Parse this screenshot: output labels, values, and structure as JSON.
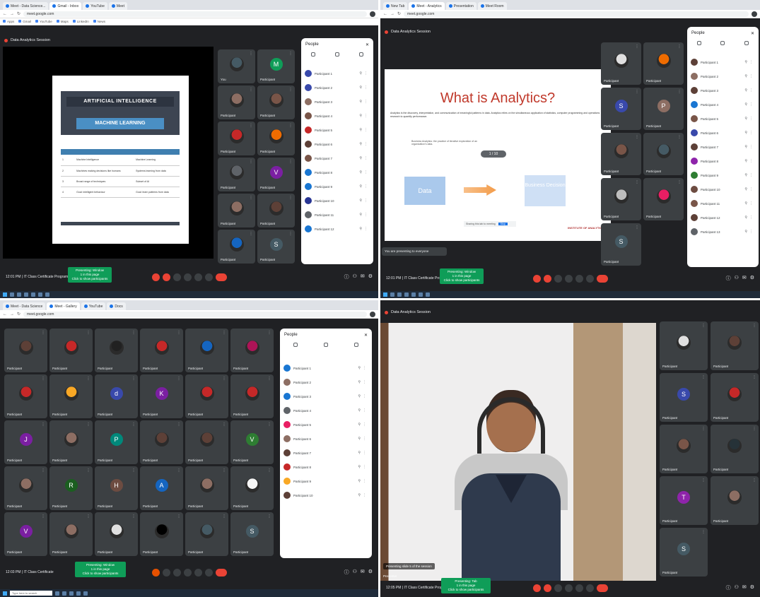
{
  "q1": {
    "tabs": [
      "Meet - Data Science...",
      "Gmail - Inbox",
      "YouTube",
      "Meet"
    ],
    "url": "meet.google.com",
    "bookmarks": [
      "Apps",
      "Gmail",
      "YouTube",
      "Maps",
      "LinkedIn",
      "News"
    ],
    "meeting_title": "Data Analytics Session",
    "slide": {
      "title1": "ARTIFICIAL INTELLIGENCE",
      "title2": "MACHINE LEARNING",
      "rows": [
        [
          "1",
          "Machine Intelligence",
          "Machine Learning"
        ],
        [
          "2",
          "Machines making decisions like humans",
          "Systems learning from data"
        ],
        [
          "3",
          "Broad range of techniques",
          "Subset of AI"
        ],
        [
          "4",
          "Goal: intelligent behaviour",
          "Goal: learn patterns from data"
        ]
      ]
    },
    "tiles": [
      {
        "name": "You",
        "color": "#455a64"
      },
      {
        "name": "Participant",
        "color": "#0f9d58",
        "letter": "M"
      },
      {
        "name": "Participant",
        "color": "#8d6e63"
      },
      {
        "name": "Participant",
        "color": "#795548"
      },
      {
        "name": "Participant",
        "color": "#c62828"
      },
      {
        "name": "Participant",
        "color": "#ef6c00"
      },
      {
        "name": "Participant",
        "color": "#5f6368"
      },
      {
        "name": "Participant",
        "color": "#7b1fa2",
        "letter": "V"
      },
      {
        "name": "Participant",
        "color": "#8d6e63"
      },
      {
        "name": "Participant",
        "color": "#5d4037"
      },
      {
        "name": "Participant",
        "color": "#1565c0"
      },
      {
        "name": "Participant",
        "color": "#455a64",
        "letter": "S"
      }
    ],
    "people_title": "People",
    "people": [
      {
        "name": "Participant 1",
        "color": "#3949ab"
      },
      {
        "name": "Participant 2",
        "color": "#3949ab"
      },
      {
        "name": "Participant 3",
        "color": "#8d6e63"
      },
      {
        "name": "Participant 4",
        "color": "#795548"
      },
      {
        "name": "Participant 5",
        "color": "#c62828"
      },
      {
        "name": "Participant 6",
        "color": "#5d4037"
      },
      {
        "name": "Participant 7",
        "color": "#795548"
      },
      {
        "name": "Participant 8",
        "color": "#1976d2"
      },
      {
        "name": "Participant 9",
        "color": "#1976d2"
      },
      {
        "name": "Participant 10",
        "color": "#283593"
      },
      {
        "name": "Participant 11",
        "color": "#5f6368"
      },
      {
        "name": "Participant 12",
        "color": "#1976d2"
      }
    ],
    "time": "12:01 PM | IT Class Certificate Program",
    "toast": "Presenting: Window\n1 in this page\nClick to show participants"
  },
  "q2": {
    "tabs": [
      "New Tab",
      "Meet - Analytics",
      "Presentation",
      "Meet Room"
    ],
    "url": "meet.google.com",
    "meeting_title": "Data Analytics Session",
    "slide": {
      "title": "What is Analytics?",
      "body": "Analytics is the discovery, interpretation, and communication of meaningful patterns in data. Analytics relies on the simultaneous application of statistics, computer programming and operations research to quantify performance.",
      "quote": "Business Analytics: the practice of iterative exploration of an organization's data.",
      "zoom_label": "1 / 10",
      "box1": "Data",
      "box2": "Business Decision",
      "logo": "INSTITUTE OF ANALYTICS",
      "share_text": "Sharing this tab to meeting",
      "share_btn": "Stop"
    },
    "stop_presenting": "You are presenting to everyone",
    "people_title": "People",
    "people": [
      {
        "name": "Participant 1",
        "color": "#5d4037"
      },
      {
        "name": "Participant 2",
        "color": "#8d6e63"
      },
      {
        "name": "Participant 3",
        "color": "#5d4037"
      },
      {
        "name": "Participant 4",
        "color": "#1976d2"
      },
      {
        "name": "Participant 5",
        "color": "#795548"
      },
      {
        "name": "Participant 6",
        "color": "#3949ab"
      },
      {
        "name": "Participant 7",
        "color": "#5d4037"
      },
      {
        "name": "Participant 8",
        "color": "#8e24aa"
      },
      {
        "name": "Participant 9",
        "color": "#2e7d32"
      },
      {
        "name": "Participant 10",
        "color": "#6d4c41"
      },
      {
        "name": "Participant 11",
        "color": "#795548"
      },
      {
        "name": "Participant 12",
        "color": "#5d4037"
      },
      {
        "name": "Participant 13",
        "color": "#5f6368"
      }
    ],
    "tiles": [
      {
        "name": "Participant",
        "color": "#e0e0e0"
      },
      {
        "name": "Participant",
        "color": "#ef6c00"
      },
      {
        "name": "Participant",
        "color": "#3949ab",
        "letter": "S"
      },
      {
        "name": "Participant",
        "color": "#8d6e63",
        "letter": "P"
      },
      {
        "name": "Participant",
        "color": "#795548"
      },
      {
        "name": "Participant",
        "color": "#455a64"
      },
      {
        "name": "Participant",
        "color": "#bdbdbd"
      },
      {
        "name": "Participant",
        "color": "#e91e63"
      },
      {
        "name": "Participant",
        "color": "#455a64",
        "letter": "S"
      }
    ],
    "time": "12:01 PM | IT Class Certificate Program",
    "toast": "Presenting: Window\n1 in this page\nClick to show participants"
  },
  "q3": {
    "tabs": [
      "Meet - Data Science",
      "Meet - Gallery",
      "YouTube",
      "Docs"
    ],
    "url": "meet.google.com",
    "people_title": "People",
    "people": [
      {
        "name": "Participant 1",
        "color": "#1976d2"
      },
      {
        "name": "Participant 2",
        "color": "#8d6e63"
      },
      {
        "name": "Participant 3",
        "color": "#1976d2"
      },
      {
        "name": "Participant 4",
        "color": "#5f6368"
      },
      {
        "name": "Participant 5",
        "color": "#e91e63"
      },
      {
        "name": "Participant 6",
        "color": "#8d6e63"
      },
      {
        "name": "Participant 7",
        "color": "#5d4037"
      },
      {
        "name": "Participant 8",
        "color": "#c62828"
      },
      {
        "name": "Participant 9",
        "color": "#f9a825"
      },
      {
        "name": "Participant 10",
        "color": "#5d4037"
      }
    ],
    "grid": [
      {
        "name": "Participant",
        "color": "#5d4037"
      },
      {
        "name": "Participant",
        "color": "#c62828"
      },
      {
        "name": "Participant",
        "color": "#212121"
      },
      {
        "name": "Participant",
        "color": "#c62828"
      },
      {
        "name": "Participant",
        "color": "#1565c0"
      },
      {
        "name": "Participant",
        "color": "#ad1457"
      },
      {
        "name": "Participant",
        "color": "#c62828"
      },
      {
        "name": "Participant",
        "color": "#f9a825"
      },
      {
        "name": "Participant",
        "color": "#3949ab",
        "letter": "d"
      },
      {
        "name": "Participant",
        "color": "#7b1fa2",
        "letter": "K"
      },
      {
        "name": "Participant",
        "color": "#c62828"
      },
      {
        "name": "Participant",
        "color": "#c62828"
      },
      {
        "name": "Participant",
        "color": "#7b1fa2",
        "letter": "J"
      },
      {
        "name": "Participant",
        "color": "#8d6e63"
      },
      {
        "name": "Participant",
        "color": "#00897b",
        "letter": "P"
      },
      {
        "name": "Participant",
        "color": "#5d4037"
      },
      {
        "name": "Participant",
        "color": "#5d4037"
      },
      {
        "name": "Participant",
        "color": "#2e7d32",
        "letter": "V"
      },
      {
        "name": "Participant",
        "color": "#8d6e63"
      },
      {
        "name": "Participant",
        "color": "#1b5e20",
        "letter": "R"
      },
      {
        "name": "Participant",
        "color": "#6d4c41",
        "letter": "H"
      },
      {
        "name": "Participant",
        "color": "#1565c0",
        "letter": "A"
      },
      {
        "name": "Participant",
        "color": "#8d6e63"
      },
      {
        "name": "Participant",
        "color": "#f5f5f5"
      },
      {
        "name": "Participant",
        "color": "#7b1fa2",
        "letter": "V"
      },
      {
        "name": "Participant",
        "color": "#8d6e63"
      },
      {
        "name": "Participant",
        "color": "#e0e0e0"
      },
      {
        "name": "Participant",
        "color": "#000000"
      },
      {
        "name": "Participant",
        "color": "#455a64"
      },
      {
        "name": "Participant",
        "color": "#455a64",
        "letter": "S"
      }
    ],
    "time": "12:03 PM | IT Class Certificate",
    "toast": "Presenting: Window\n1 in this page\nClick to show participants",
    "search": "Type here to search"
  },
  "q4": {
    "meeting_title": "Data Analytics Session",
    "caption": "Presenting slide 5 of the session",
    "speaker": "Presenter",
    "tiles": [
      {
        "name": "Participant",
        "color": "#e0e0e0"
      },
      {
        "name": "Participant",
        "color": "#5d4037"
      },
      {
        "name": "Participant",
        "color": "#3949ab",
        "letter": "S"
      },
      {
        "name": "Participant",
        "color": "#c62828"
      },
      {
        "name": "Participant",
        "color": "#795548"
      },
      {
        "name": "Participant",
        "color": "#263238"
      },
      {
        "name": "Participant",
        "color": "#8e24aa",
        "letter": "T"
      },
      {
        "name": "Participant",
        "color": "#8d6e63"
      },
      {
        "name": "Participant",
        "color": "#455a64",
        "letter": "S"
      }
    ],
    "time": "12:05 PM | IT Class Certificate Program",
    "toast": "Presenting: Tab\n1 in this page\nClick to show participants"
  }
}
